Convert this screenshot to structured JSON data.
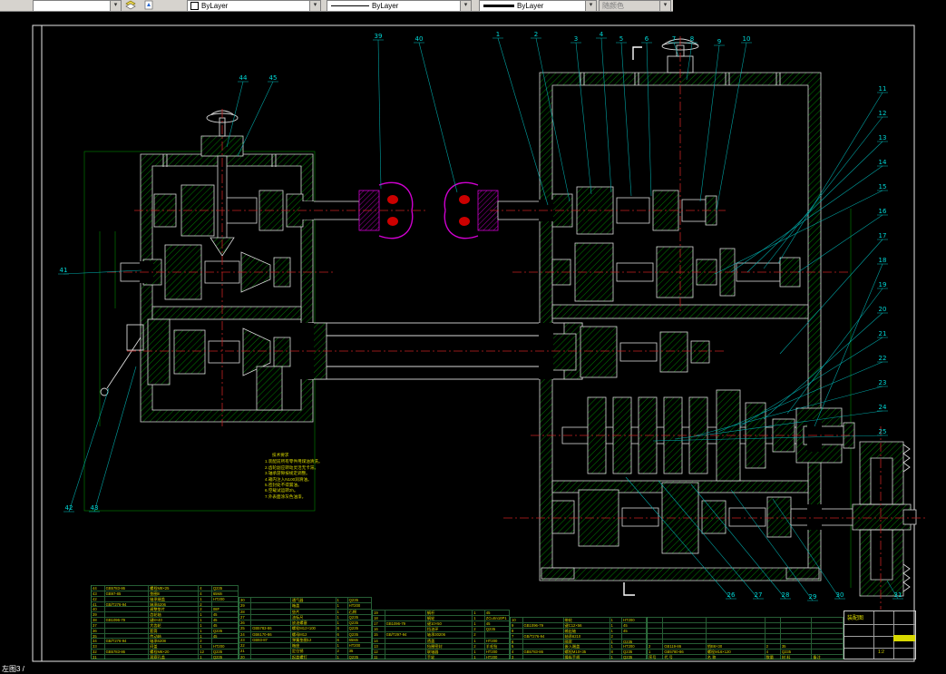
{
  "window": {
    "statusbar_text": "左图3 /"
  },
  "toolbar": {
    "layer_value": "",
    "color_value": "ByLayer",
    "linetype_value": "ByLayer",
    "lineweight_value": "ByLayer",
    "plotstyle_value": "随颜色"
  },
  "drawing": {
    "notes": {
      "title": "技术要求",
      "lines": [
        "1.装配前所有零件用煤油清洗。",
        "2.齿轮副应转动灵活无卡滞。",
        "3.轴承游隙按规定调整。",
        "4.箱内注入N100润滑油。",
        "5.密封处不得漏油。",
        "6.空载试运转2h。",
        "7.外表面涂灰色油漆。"
      ]
    },
    "callouts": [
      [
        44,
        268,
        88,
        250,
        162
      ],
      [
        45,
        301,
        88,
        262,
        172
      ],
      [
        41,
        70,
        300,
        156,
        298
      ],
      [
        42,
        76,
        562,
        120,
        428
      ],
      [
        43,
        104,
        562,
        150,
        404
      ],
      [
        39,
        417,
        42,
        420,
        208
      ],
      [
        40,
        462,
        45,
        504,
        212
      ],
      [
        1,
        549,
        40,
        604,
        226
      ],
      [
        2,
        591,
        40,
        628,
        222
      ],
      [
        3,
        635,
        45,
        652,
        214
      ],
      [
        4,
        663,
        40,
        674,
        212
      ],
      [
        5,
        685,
        45,
        696,
        216
      ],
      [
        6,
        713,
        45,
        718,
        216
      ],
      [
        7,
        743,
        45,
        748,
        62
      ],
      [
        8,
        763,
        45,
        757,
        88
      ],
      [
        9,
        793,
        48,
        772,
        222
      ],
      [
        10,
        823,
        45,
        790,
        232
      ],
      [
        11,
        973,
        100,
        858,
        290
      ],
      [
        12,
        973,
        127,
        842,
        296
      ],
      [
        13,
        973,
        154,
        824,
        300
      ],
      [
        14,
        973,
        181,
        806,
        300
      ],
      [
        15,
        973,
        208,
        788,
        302
      ],
      [
        16,
        973,
        235,
        880,
        300
      ],
      [
        17,
        973,
        262,
        860,
        390
      ],
      [
        18,
        973,
        289,
        898,
        470
      ],
      [
        19,
        973,
        316,
        868,
        456
      ],
      [
        20,
        973,
        343,
        842,
        462
      ],
      [
        21,
        973,
        370,
        816,
        470
      ],
      [
        22,
        973,
        397,
        792,
        476
      ],
      [
        23,
        973,
        424,
        768,
        480
      ],
      [
        24,
        973,
        451,
        744,
        484
      ],
      [
        25,
        973,
        478,
        720,
        486
      ],
      [
        26,
        806,
        658,
        690,
        526
      ],
      [
        27,
        836,
        658,
        726,
        530
      ],
      [
        28,
        866,
        658,
        762,
        534
      ],
      [
        29,
        896,
        660,
        806,
        540
      ],
      [
        30,
        926,
        658,
        852,
        550
      ],
      [
        31,
        990,
        658,
        978,
        640
      ]
    ]
  },
  "bom": {
    "groups": [
      {
        "rows": [
          [
            "44",
            "GB5783-86",
            "螺栓M8×25",
            "4",
            "Q235"
          ],
          [
            "43",
            "GB97-85",
            "垫圈8",
            "4",
            "65Mn"
          ],
          [
            "42",
            "",
            "轴承端盖",
            "1",
            "HT200"
          ],
          [
            "41",
            "GB/T276-94",
            "轴承6206",
            "2",
            ""
          ],
          [
            "40",
            "",
            "调整垫片",
            "2",
            "08F"
          ],
          [
            "39",
            "",
            "齿轮轴",
            "1",
            "45"
          ],
          [
            "38",
            "GB1096-79",
            "键8×40",
            "1",
            "45"
          ],
          [
            "37",
            "",
            "大齿轮",
            "1",
            "45"
          ],
          [
            "36",
            "",
            "套筒",
            "1",
            "Q235"
          ],
          [
            "35",
            "",
            "传动轴",
            "1",
            "45"
          ],
          [
            "34",
            "GB/T276-94",
            "轴承6208",
            "2",
            ""
          ],
          [
            "33",
            "",
            "闷盖",
            "1",
            "HT200"
          ],
          [
            "32",
            "GB5783-86",
            "螺栓M6×20",
            "12",
            "Q235"
          ],
          [
            "31",
            "",
            "观察孔盖",
            "1",
            "Q235"
          ]
        ]
      },
      {
        "rows": [
          [
            "30",
            "",
            "通气器",
            "1",
            "Q235"
          ],
          [
            "29",
            "",
            "箱盖",
            "1",
            "HT200"
          ],
          [
            "28",
            "",
            "垫片",
            "1",
            "石棉"
          ],
          [
            "27",
            "",
            "油标尺",
            "1",
            "Q235"
          ],
          [
            "26",
            "",
            "放油螺塞",
            "1",
            "Q235"
          ],
          [
            "25",
            "GB5783-86",
            "螺栓M12×100",
            "6",
            "Q235"
          ],
          [
            "24",
            "GB6170-86",
            "螺母M12",
            "6",
            "Q235"
          ],
          [
            "23",
            "GB93-87",
            "弹簧垫圈12",
            "6",
            "65Mn"
          ],
          [
            "22",
            "",
            "箱座",
            "1",
            "HT200"
          ],
          [
            "21",
            "",
            "定位销",
            "2",
            "35"
          ],
          [
            "20",
            "",
            "起盖螺钉",
            "1",
            "Q235"
          ]
        ]
      },
      {
        "rows": [
          [
            "19",
            "",
            "蜗杆",
            "1",
            "45"
          ],
          [
            "18",
            "",
            "蜗轮",
            "1",
            "ZCuSn10P1"
          ],
          [
            "17",
            "GB1096-79",
            "键10×50",
            "1",
            "45"
          ],
          [
            "16",
            "",
            "挡油环",
            "2",
            "Q235"
          ],
          [
            "15",
            "GB/T297-94",
            "轴承30206",
            "2",
            ""
          ],
          [
            "14",
            "",
            "透盖",
            "1",
            "HT200"
          ],
          [
            "13",
            "",
            "毡圈密封",
            "2",
            "羊毛毡"
          ],
          [
            "12",
            "",
            "联轴器",
            "1",
            "HT200"
          ],
          [
            "11",
            "",
            "手轮",
            "1",
            "HT200"
          ]
        ]
      },
      {
        "rows": [
          [
            "10",
            "",
            "带轮",
            "1",
            "HT200"
          ],
          [
            "9",
            "GB1096-79",
            "键C12×56",
            "1",
            "45"
          ],
          [
            "8",
            "",
            "输出轴",
            "1",
            "45"
          ],
          [
            "7",
            "GB/T276-94",
            "轴承6210",
            "2",
            ""
          ],
          [
            "6",
            "",
            "隔套",
            "1",
            "Q235"
          ],
          [
            "5",
            "",
            "嵌入端盖",
            "1",
            "HT200"
          ],
          [
            "4",
            "GB5783-86",
            "螺栓M10×35",
            "8",
            "Q235"
          ],
          [
            "3",
            "",
            "操纵手柄",
            "1",
            "Q235"
          ]
        ]
      },
      {
        "rows": [
          [
            "",
            "",
            "",
            "",
            "",
            ""
          ],
          [
            "",
            "",
            "",
            "",
            "",
            ""
          ],
          [
            "",
            "",
            "",
            "",
            "",
            ""
          ],
          [
            "",
            "",
            "",
            "",
            "",
            ""
          ],
          [
            "",
            "",
            "",
            "",
            "",
            ""
          ],
          [
            "2",
            "GB119-86",
            "销B6×30",
            "2",
            "35",
            ""
          ],
          [
            "1",
            "GB5780-86",
            "螺栓M16×120",
            "4",
            "Q235",
            ""
          ],
          [
            "序号",
            "代  号",
            "名  称",
            "数量",
            "材  料",
            "备注"
          ]
        ]
      }
    ]
  },
  "titleblock": {
    "title": "装配图",
    "scale": "1:2"
  }
}
